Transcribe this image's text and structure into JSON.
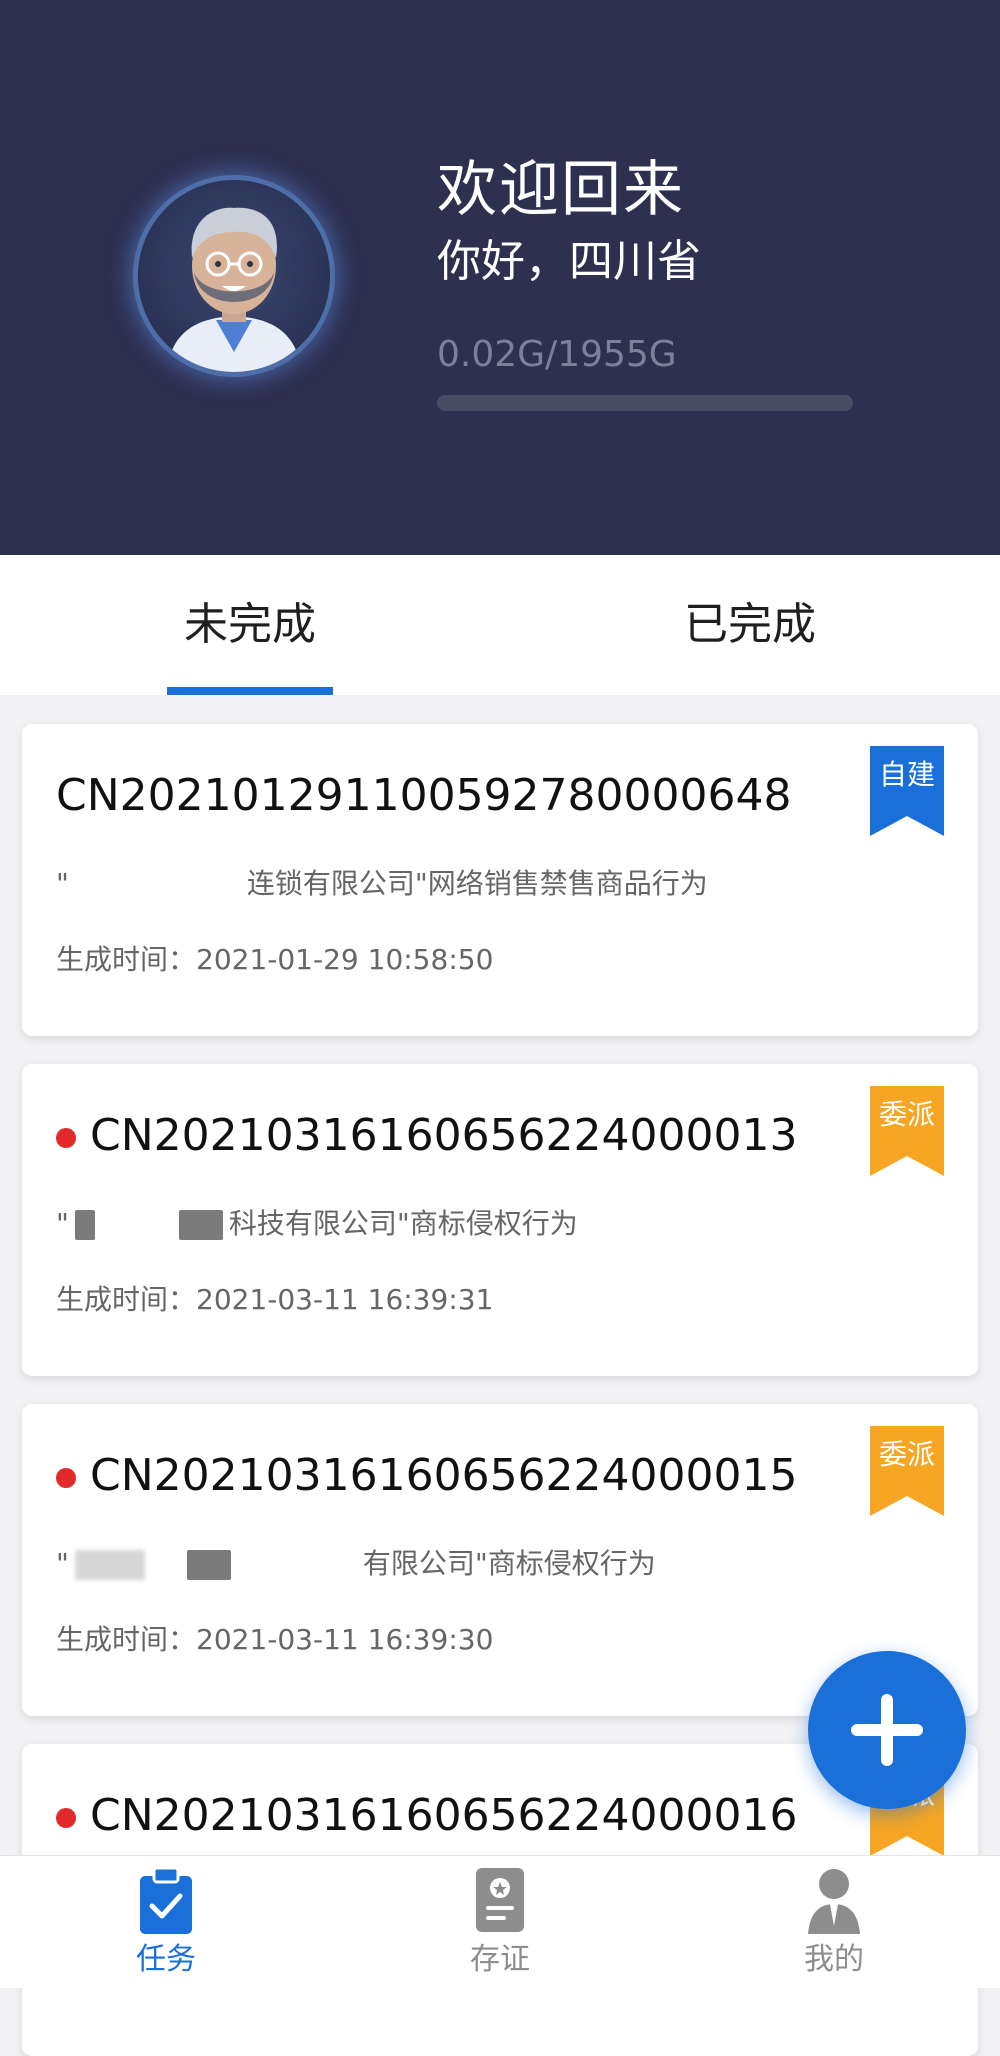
{
  "header": {
    "welcome": "欢迎回来",
    "greeting": "你好，四川省",
    "storage_text": "0.02G/1955G",
    "storage_used_fraction": 1e-05
  },
  "tabs": [
    {
      "label": "未完成",
      "active": true
    },
    {
      "label": "已完成",
      "active": false
    }
  ],
  "cards": [
    {
      "code": "CN202101291100592780000648",
      "has_dot": false,
      "desc_prefix": "\"",
      "desc_suffix": "连锁有限公司\"网络销售禁售商品行为",
      "time": "生成时间：2021-01-29 10:58:50",
      "badge": "自建",
      "badge_color": "#1a6fd8"
    },
    {
      "code": "CN20210316160656224000013",
      "has_dot": true,
      "desc_prefix": "\"",
      "desc_suffix": "科技有限公司\"商标侵权行为",
      "time": "生成时间：2021-03-11 16:39:31",
      "badge": "委派",
      "badge_color": "#f6a623"
    },
    {
      "code": "CN20210316160656224000015",
      "has_dot": true,
      "desc_prefix": "\"",
      "desc_suffix": "有限公司\"商标侵权行为",
      "time": "生成时间：2021-03-11 16:39:30",
      "badge": "委派",
      "badge_color": "#f6a623"
    },
    {
      "code": "CN20210316160656224000016",
      "has_dot": true,
      "badge": "委派",
      "badge_color": "#f6a623"
    }
  ],
  "fab": {
    "icon": "plus-icon"
  },
  "bottom_nav": [
    {
      "label": "任务",
      "icon": "clipboard-check-icon",
      "active": true
    },
    {
      "label": "存证",
      "icon": "certificate-icon",
      "active": false
    },
    {
      "label": "我的",
      "icon": "user-icon",
      "active": false
    }
  ],
  "colors": {
    "header_bg": "#2e3050",
    "accent": "#1a6fd8",
    "badge_orange": "#f6a623",
    "dot_red": "#e22a2a"
  }
}
